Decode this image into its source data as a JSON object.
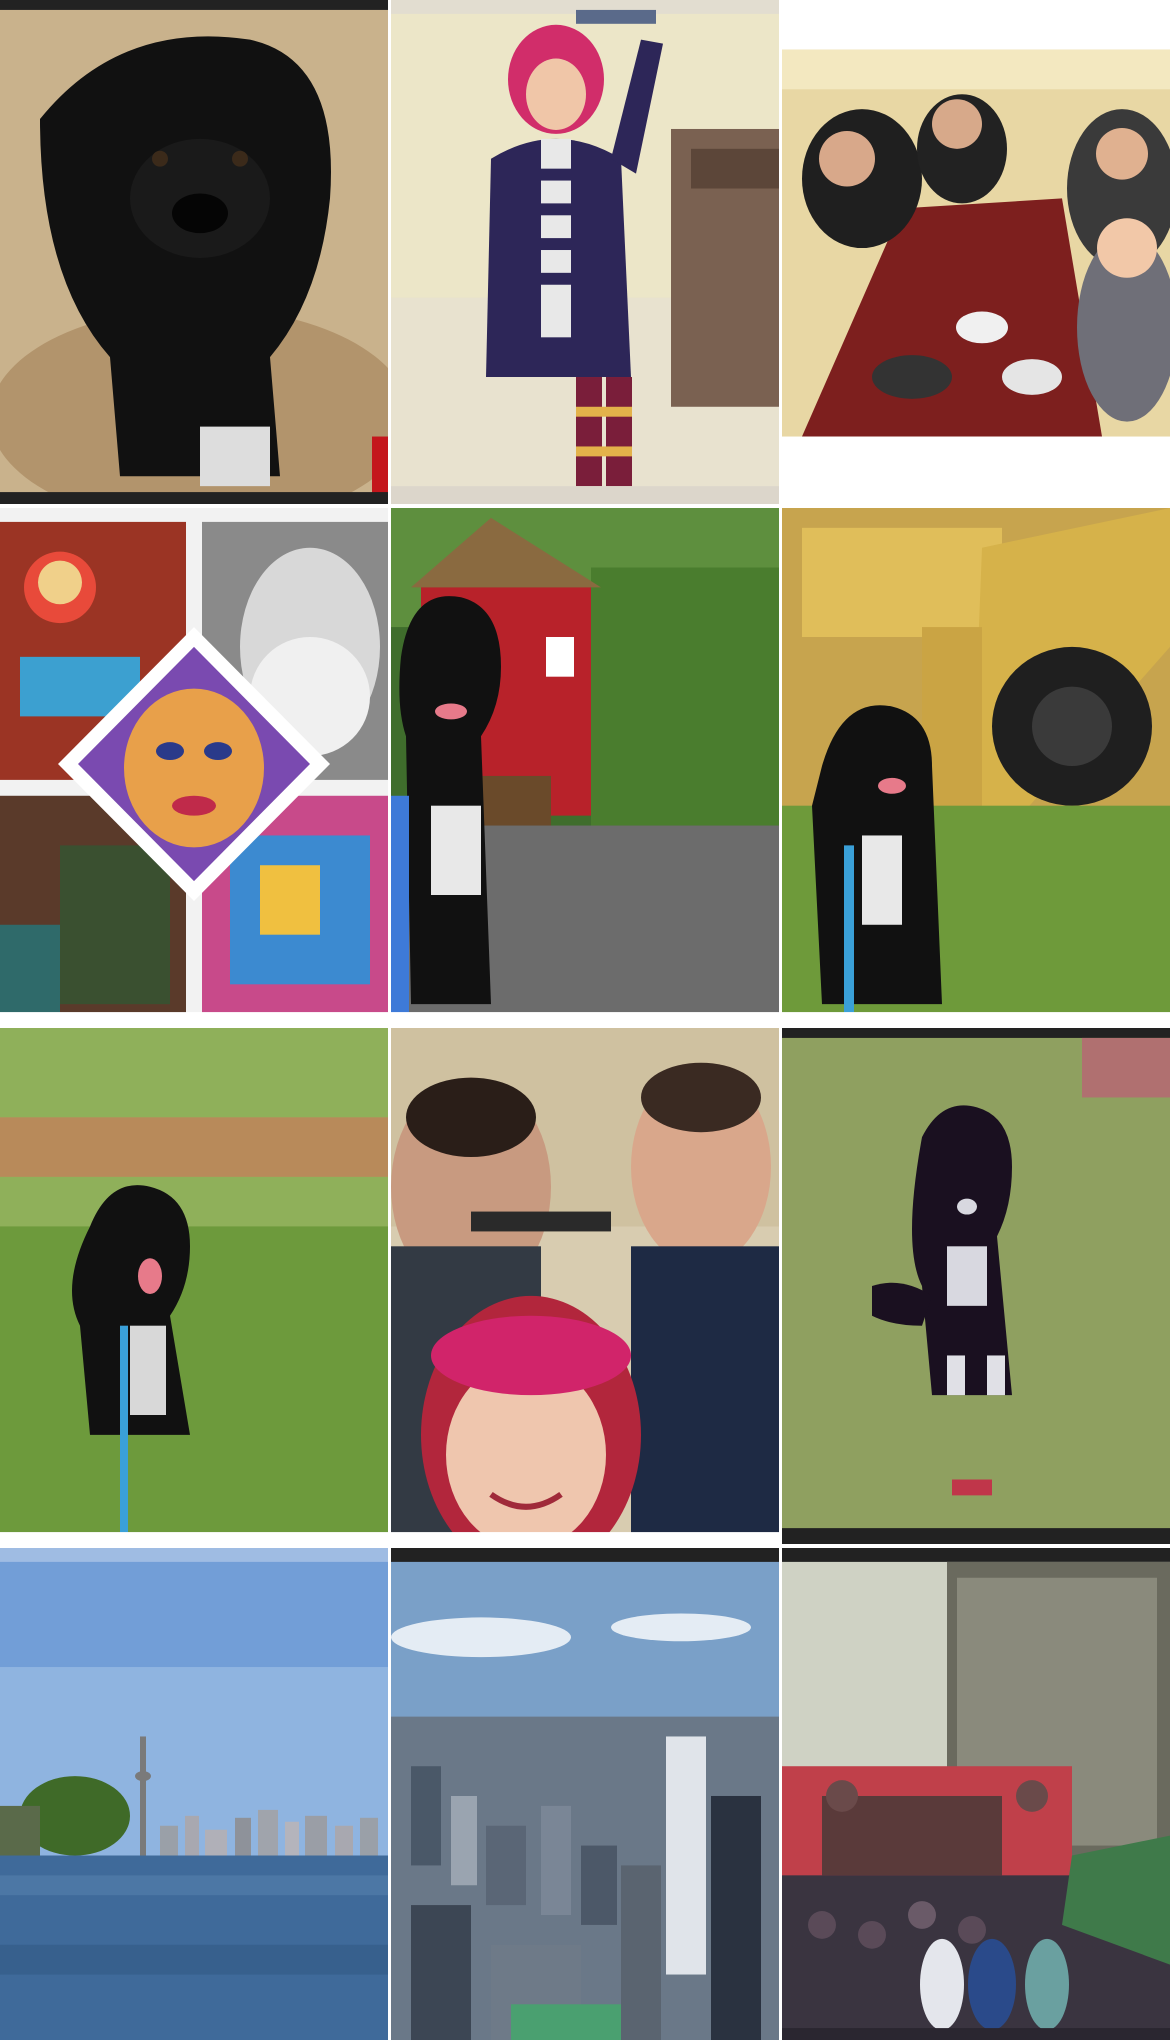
{
  "grid": {
    "tiles": [
      {
        "subject": "black-dog-on-bed"
      },
      {
        "subject": "woman-with-striped-scarf"
      },
      {
        "subject": "friends-at-diner-table"
      },
      {
        "subject": "graffiti-collage"
      },
      {
        "subject": "dog-by-red-house"
      },
      {
        "subject": "dog-by-yellow-tractor"
      },
      {
        "subject": "dog-in-cornfield"
      },
      {
        "subject": "three-friends-selfie"
      },
      {
        "subject": "dog-sitting-on-lawn"
      },
      {
        "subject": "city-skyline-across-water"
      },
      {
        "subject": "aerial-city-view"
      },
      {
        "subject": "concert-crowd-in-rain"
      }
    ]
  },
  "colors": {
    "sky": "#8fb4e0",
    "grass": "#6f9e3d",
    "dog": "#111111",
    "diner_red": "#7d1f1e",
    "tractor_yellow": "#d6b24a"
  }
}
